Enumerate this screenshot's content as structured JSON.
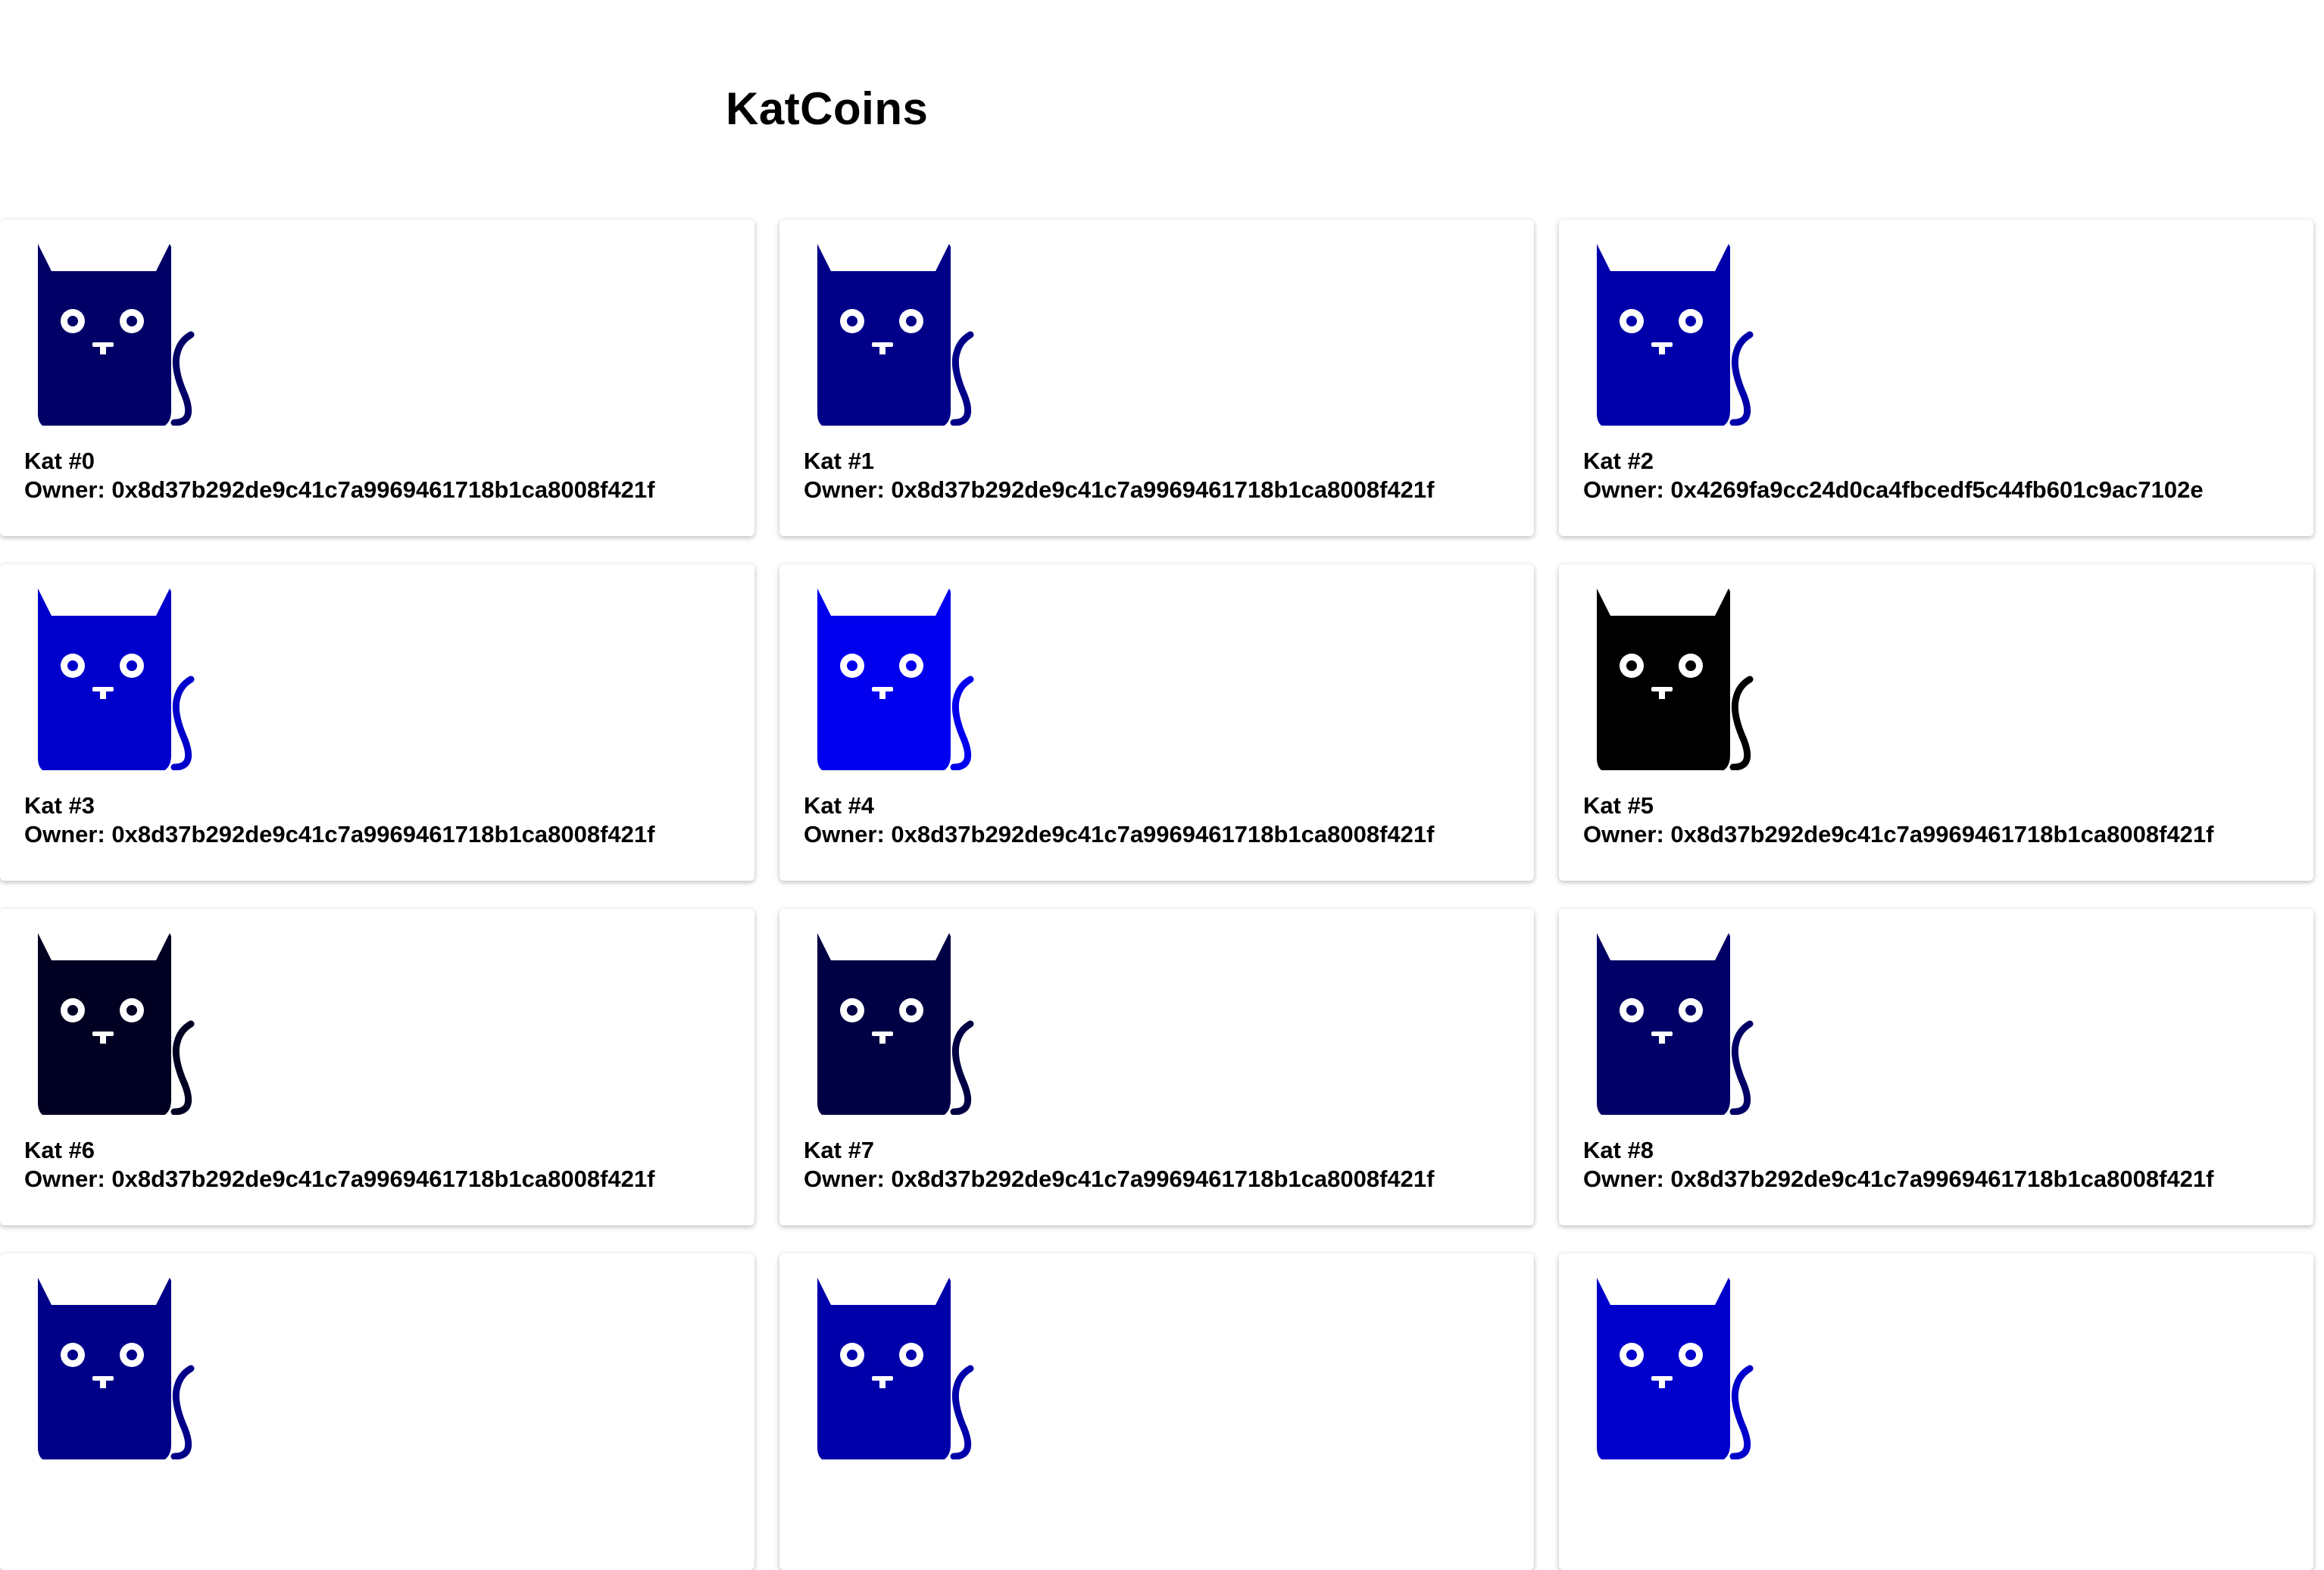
{
  "page": {
    "title": "KatCoins"
  },
  "owner_prefix": "Owner: ",
  "cards": [
    {
      "name": "Kat #0",
      "owner": "Owner: 0x8d37b292de9c41c7a9969461718b1ca8008f421f",
      "color": "#000066"
    },
    {
      "name": "Kat #1",
      "owner": "Owner: 0x8d37b292de9c41c7a9969461718b1ca8008f421f",
      "color": "#000088"
    },
    {
      "name": "Kat #2",
      "owner": "Owner: 0x4269fa9cc24d0ca4fbcedf5c44fb601c9ac7102e",
      "color": "#0000aa"
    },
    {
      "name": "Kat #3",
      "owner": "Owner: 0x8d37b292de9c41c7a9969461718b1ca8008f421f",
      "color": "#0000cc"
    },
    {
      "name": "Kat #4",
      "owner": "Owner: 0x8d37b292de9c41c7a9969461718b1ca8008f421f",
      "color": "#0000ee"
    },
    {
      "name": "Kat #5",
      "owner": "Owner: 0x8d37b292de9c41c7a9969461718b1ca8008f421f",
      "color": "#000000"
    },
    {
      "name": "Kat #6",
      "owner": "Owner: 0x8d37b292de9c41c7a9969461718b1ca8008f421f",
      "color": "#000022"
    },
    {
      "name": "Kat #7",
      "owner": "Owner: 0x8d37b292de9c41c7a9969461718b1ca8008f421f",
      "color": "#000044"
    },
    {
      "name": "Kat #8",
      "owner": "Owner: 0x8d37b292de9c41c7a9969461718b1ca8008f421f",
      "color": "#000066"
    },
    {
      "name": "",
      "owner": "",
      "color": "#000088"
    },
    {
      "name": "",
      "owner": "",
      "color": "#0000aa"
    },
    {
      "name": "",
      "owner": "",
      "color": "#0000cc"
    }
  ],
  "icons": {
    "cat": "cat-icon"
  }
}
